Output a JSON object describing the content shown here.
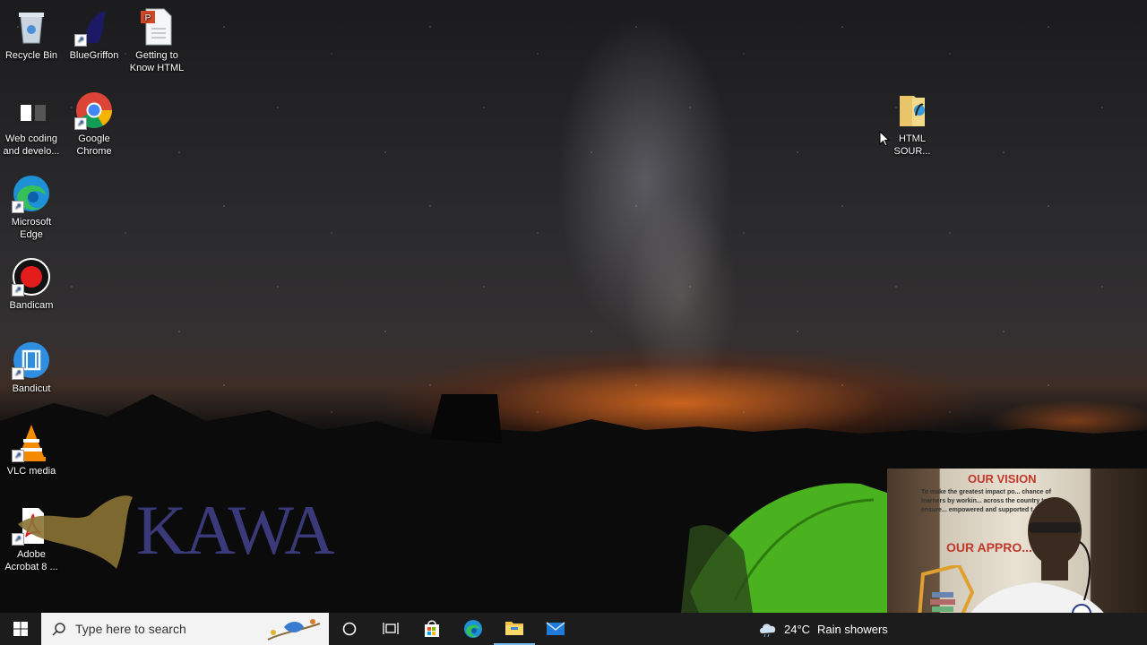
{
  "desktop": {
    "icons": [
      {
        "label": "Recycle Bin"
      },
      {
        "label": "BlueGriffon"
      },
      {
        "label": "Getting to Know HTML"
      },
      {
        "label": "Web coding and develo..."
      },
      {
        "label": "Google Chrome"
      },
      {
        "label": "Microsoft Edge"
      },
      {
        "label": "Bandicam"
      },
      {
        "label": "Bandicut"
      },
      {
        "label": "VLC media"
      },
      {
        "label": "Adobe Acrobat 8 ..."
      },
      {
        "label": "HTML SOUR..."
      }
    ]
  },
  "watermark": {
    "text": "KAWA",
    "color": "#3a3a7a",
    "mark_color": "#8a7233"
  },
  "webcam": {
    "poster_heading_1": "OUR VISION",
    "poster_text": "To make the greatest impact po... chance of learners by workin... across the country to ensure... empowered and supported t...",
    "poster_heading_2": "OUR APPRO...",
    "poster_heading_color": "#c0392b"
  },
  "taskbar": {
    "search_placeholder": "Type here to search",
    "weather_temp": "24°C",
    "weather_desc": "Rain showers",
    "apps": [
      "cortana-icon",
      "task-view-icon",
      "store-icon",
      "edge-icon",
      "file-explorer-icon",
      "mail-icon"
    ]
  },
  "colors": {
    "taskbar": "#1c1c1c",
    "accent": "#0078d7"
  }
}
